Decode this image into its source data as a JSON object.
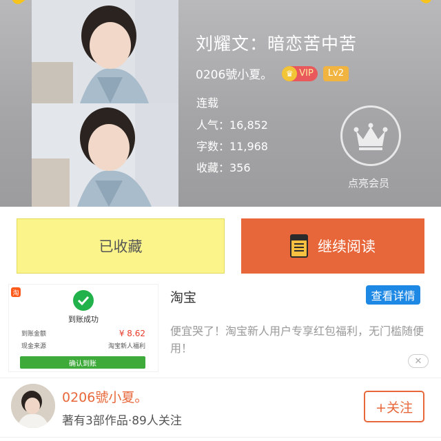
{
  "book": {
    "title": "刘耀文：暗恋苦中苦",
    "author": "0206號小夏。",
    "vip_label": "VIP",
    "level_label": "Lv2",
    "status": "连载",
    "popularity": "人气：16,852",
    "word_count": "字数：11,968",
    "favorites": "收藏：356",
    "member_label": "点亮会员"
  },
  "actions": {
    "favorited_label": "已收藏",
    "continue_label": "继续阅读"
  },
  "ad": {
    "receipt_title": "到账成功",
    "receipt_amount_label": "到账金额",
    "receipt_amount": "¥ 8.62",
    "receipt_source_label": "现金来源",
    "receipt_source": "淘宝新人福利",
    "receipt_confirm": "确认到账",
    "logo_glyph": "淘",
    "source": "淘宝",
    "detail_label": "查看详情",
    "description": "便宜哭了！淘宝新人用户专享红包福利，无门槛随便用！",
    "close_glyph": "✕"
  },
  "author_profile": {
    "name": "0206號小夏。",
    "meta": "著有3部作品·89人关注",
    "follow_label": "+关注"
  },
  "colors": {
    "accent_orange": "#e8673a",
    "favorite_yellow": "#fbf48a",
    "detail_blue": "#1e88e5",
    "vip_red": "#e9595b",
    "level_gold": "#f2b441"
  },
  "icons": [
    "crown-icon",
    "book-icon",
    "check-icon",
    "close-icon",
    "taobao-logo-icon"
  ]
}
